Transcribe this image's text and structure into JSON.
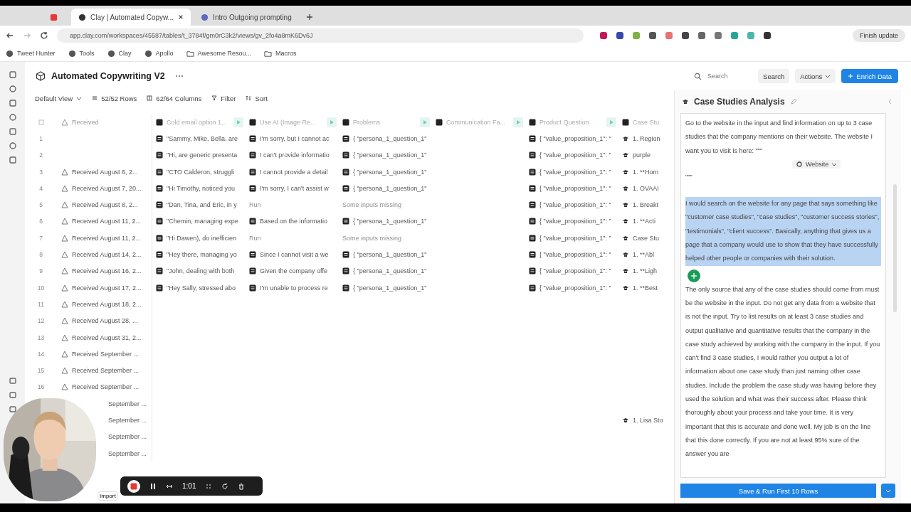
{
  "browser": {
    "tabs": [
      {
        "kind": "pinned",
        "selected": false
      },
      {
        "kind": "page",
        "title": "Clay | Automated Copyw...",
        "selected": true
      },
      {
        "kind": "page",
        "title": "Intro Outgoing prompting",
        "selected": false
      }
    ],
    "address": "app.clay.com/workspaces/45587/tables/t_3784f/gm0rC3k2/views/gv_2fo4a8mK6Dv6J",
    "bookmarks": [
      {
        "kind": "site",
        "label": "Tweet Hunter"
      },
      {
        "kind": "site",
        "label": "Tools"
      },
      {
        "kind": "site",
        "label": "Clay"
      },
      {
        "kind": "site",
        "label": "Apollo"
      },
      {
        "kind": "folder",
        "label": "Awesome Resou..."
      },
      {
        "kind": "folder",
        "label": "Macros"
      }
    ],
    "update_button": "Finish update"
  },
  "app": {
    "title": "Automated Copywriting V2",
    "search_placeholder": "Search",
    "search_button": "Search",
    "actions": "Actions",
    "enrich": "Enrich Data",
    "toolbar": {
      "view": "Default View",
      "rows": "52/52 Rows",
      "columns": "62/64 Columns",
      "filter": "Filter",
      "sort": "Sort"
    }
  },
  "table": {
    "received_header": "Received",
    "columns": [
      {
        "label": "Cold email option 1...",
        "run_button": true
      },
      {
        "label": "Use AI (Image Re...",
        "run_button": true
      },
      {
        "label": "Problems",
        "run_button": true
      },
      {
        "label": "Communication Fa...",
        "run_button": true
      },
      {
        "label": "Product Question",
        "run_button": true
      },
      {
        "label": "Case Stu",
        "run_button": false
      }
    ],
    "rows": [
      {
        "number": "1",
        "cells": [
          {
            "kind": "result",
            "text": "\"Sammy, Mike, Bella, are"
          },
          {
            "kind": "result",
            "text": "I'm sorry, but I cannot ac"
          },
          {
            "kind": "result",
            "text": "{ \"persona_1_question_1\""
          },
          {
            "kind": "empty"
          },
          {
            "kind": "result",
            "text": "{ \"value_proposition_1\": \""
          },
          {
            "kind": "result",
            "text": "1. Region"
          }
        ]
      },
      {
        "number": "2",
        "cells": [
          {
            "kind": "result",
            "text": "\"Hi, are generic presenta"
          },
          {
            "kind": "result",
            "text": "I can't provide informatio"
          },
          {
            "kind": "result",
            "text": "{ \"persona_1_question_1\""
          },
          {
            "kind": "empty"
          },
          {
            "kind": "result",
            "text": "{ \"value_proposition_1\": \""
          },
          {
            "kind": "result",
            "text": "purple"
          }
        ]
      },
      {
        "number": "3",
        "received": "Received August 6, 2...",
        "cells": [
          {
            "kind": "result",
            "text": "\"CTO Calderon, struggli"
          },
          {
            "kind": "result",
            "text": "I cannot provide a detail"
          },
          {
            "kind": "result",
            "text": "{ \"persona_1_question_1\""
          },
          {
            "kind": "empty"
          },
          {
            "kind": "result",
            "text": "{ \"value_proposition_1\": \""
          },
          {
            "kind": "result",
            "text": "1. **Hom"
          }
        ]
      },
      {
        "number": "4",
        "received": "Received August 7, 20...",
        "cells": [
          {
            "kind": "result",
            "text": "\"Hi Timothy, noticed you"
          },
          {
            "kind": "result",
            "text": "I'm sorry, I can't assist w"
          },
          {
            "kind": "result",
            "text": "{ \"persona_1_question_1\""
          },
          {
            "kind": "empty"
          },
          {
            "kind": "result",
            "text": "{ \"value_proposition_1\": \""
          },
          {
            "kind": "result",
            "text": "1. OVAAI"
          }
        ]
      },
      {
        "number": "5",
        "received": "Received August 8, 2...",
        "cells": [
          {
            "kind": "result",
            "text": "\"Dan, Tina, and Eric, in y"
          },
          {
            "kind": "muted",
            "text": "Run"
          },
          {
            "kind": "muted",
            "text": "Some inputs missing"
          },
          {
            "kind": "empty"
          },
          {
            "kind": "result",
            "text": "{ \"value_proposition_1\": \""
          },
          {
            "kind": "result",
            "text": "1. Breakt"
          }
        ]
      },
      {
        "number": "6",
        "received": "Received August 11, 2...",
        "cells": [
          {
            "kind": "result",
            "text": "\"Chemin, managing expe"
          },
          {
            "kind": "result",
            "text": "Based on the informatio"
          },
          {
            "kind": "result",
            "text": "{ \"persona_1_question_1\""
          },
          {
            "kind": "empty"
          },
          {
            "kind": "result",
            "text": "{ \"value_proposition_1\": \""
          },
          {
            "kind": "result",
            "text": "1. **Acti"
          }
        ]
      },
      {
        "number": "7",
        "received": "Received August 11, 2...",
        "cells": [
          {
            "kind": "result",
            "text": "\"Hi Dawen), do inefficien"
          },
          {
            "kind": "muted",
            "text": "Run"
          },
          {
            "kind": "muted",
            "text": "Some inputs missing"
          },
          {
            "kind": "empty"
          },
          {
            "kind": "result",
            "text": "{ \"value_proposition_1\": \""
          },
          {
            "kind": "result",
            "text": "Case Stu"
          }
        ]
      },
      {
        "number": "8",
        "received": "Received August 14, 2...",
        "cells": [
          {
            "kind": "result",
            "text": "\"Hey there, managing yo"
          },
          {
            "kind": "result",
            "text": "Since I cannot visit a we"
          },
          {
            "kind": "result",
            "text": "{ \"persona_1_question_1\""
          },
          {
            "kind": "empty"
          },
          {
            "kind": "result",
            "text": "{ \"value_proposition_1\": \""
          },
          {
            "kind": "result",
            "text": "1. **Abl"
          }
        ]
      },
      {
        "number": "9",
        "received": "Received August 16, 2...",
        "cells": [
          {
            "kind": "result",
            "text": "\"John, dealing with both"
          },
          {
            "kind": "result",
            "text": "Given the company offe"
          },
          {
            "kind": "result",
            "text": "{ \"persona_1_question_1\""
          },
          {
            "kind": "empty"
          },
          {
            "kind": "result",
            "text": "{ \"value_proposition_1\": \""
          },
          {
            "kind": "result",
            "text": "1. **Ligh"
          }
        ]
      },
      {
        "number": "10",
        "received": "Received August 17, 2...",
        "cells": [
          {
            "kind": "result",
            "text": "\"Hey Sally, stressed abo"
          },
          {
            "kind": "result",
            "text": "I'm unable to process re"
          },
          {
            "kind": "result",
            "text": "{ \"persona_1_question_1\""
          },
          {
            "kind": "empty"
          },
          {
            "kind": "result",
            "text": "{ \"value_proposition_1\": \""
          },
          {
            "kind": "result",
            "text": "1. **Best"
          }
        ]
      },
      {
        "number": "11",
        "received": "Received August 18, 2..."
      },
      {
        "number": "12",
        "received": "Received August 28, ..."
      },
      {
        "number": "13",
        "received": "Received August 31, 2..."
      },
      {
        "number": "14",
        "received": "Received September ..."
      },
      {
        "number": "15",
        "received": "Received September ..."
      },
      {
        "number": "16",
        "received": "Received September ..."
      },
      {
        "covered": true,
        "received": "September ..."
      },
      {
        "covered": true,
        "received": "September ...",
        "cells": [
          {
            "kind": "empty"
          },
          {
            "kind": "empty"
          },
          {
            "kind": "empty"
          },
          {
            "kind": "empty"
          },
          {
            "kind": "empty"
          },
          {
            "kind": "result",
            "text": "1. Lisa Sto"
          }
        ]
      },
      {
        "covered": true,
        "received": "September ..."
      },
      {
        "covered": true,
        "received": "September ..."
      }
    ]
  },
  "footer": {
    "import": "Import"
  },
  "panel": {
    "title": "Case Studies Analysis",
    "intro": "Go to the website in the input and find information on up to 3 case studies that the company mentions on their website. The website I want you to visit is here: \"\"\"",
    "chip": "Website",
    "intro_end": "\"\"\"",
    "highlight": "I would search on the website for any page that says something like \"customer case studies\", \"case studies\", \"customer success stories\", \"testimonials\", \"client success\". Basically, anything that gives us a page that a company would use to show that they have successfully helped other people or companies with their solution.",
    "body": "The only source that any of the case studies should come from must be the website in the input. Do not get any data from a website that is not the input. Try to list results on at least 3 case studies and output qualitative and quantitative results that the company in the case study achieved by working with the company in the input. If you can't find 3 case studies, I would rather you output a lot of information about one case study than just naming other case studies. Include the problem the case study was having before they used the solution and what was their success after. Please think thoroughly about your process and take your time. It is very important that this is accurate and done well. My job is on the line that this done correctly. If you are not at least 95% sure of the answer you are",
    "save_button": "Save & Run First 10 Rows"
  },
  "recorder": {
    "time": "1:01"
  }
}
